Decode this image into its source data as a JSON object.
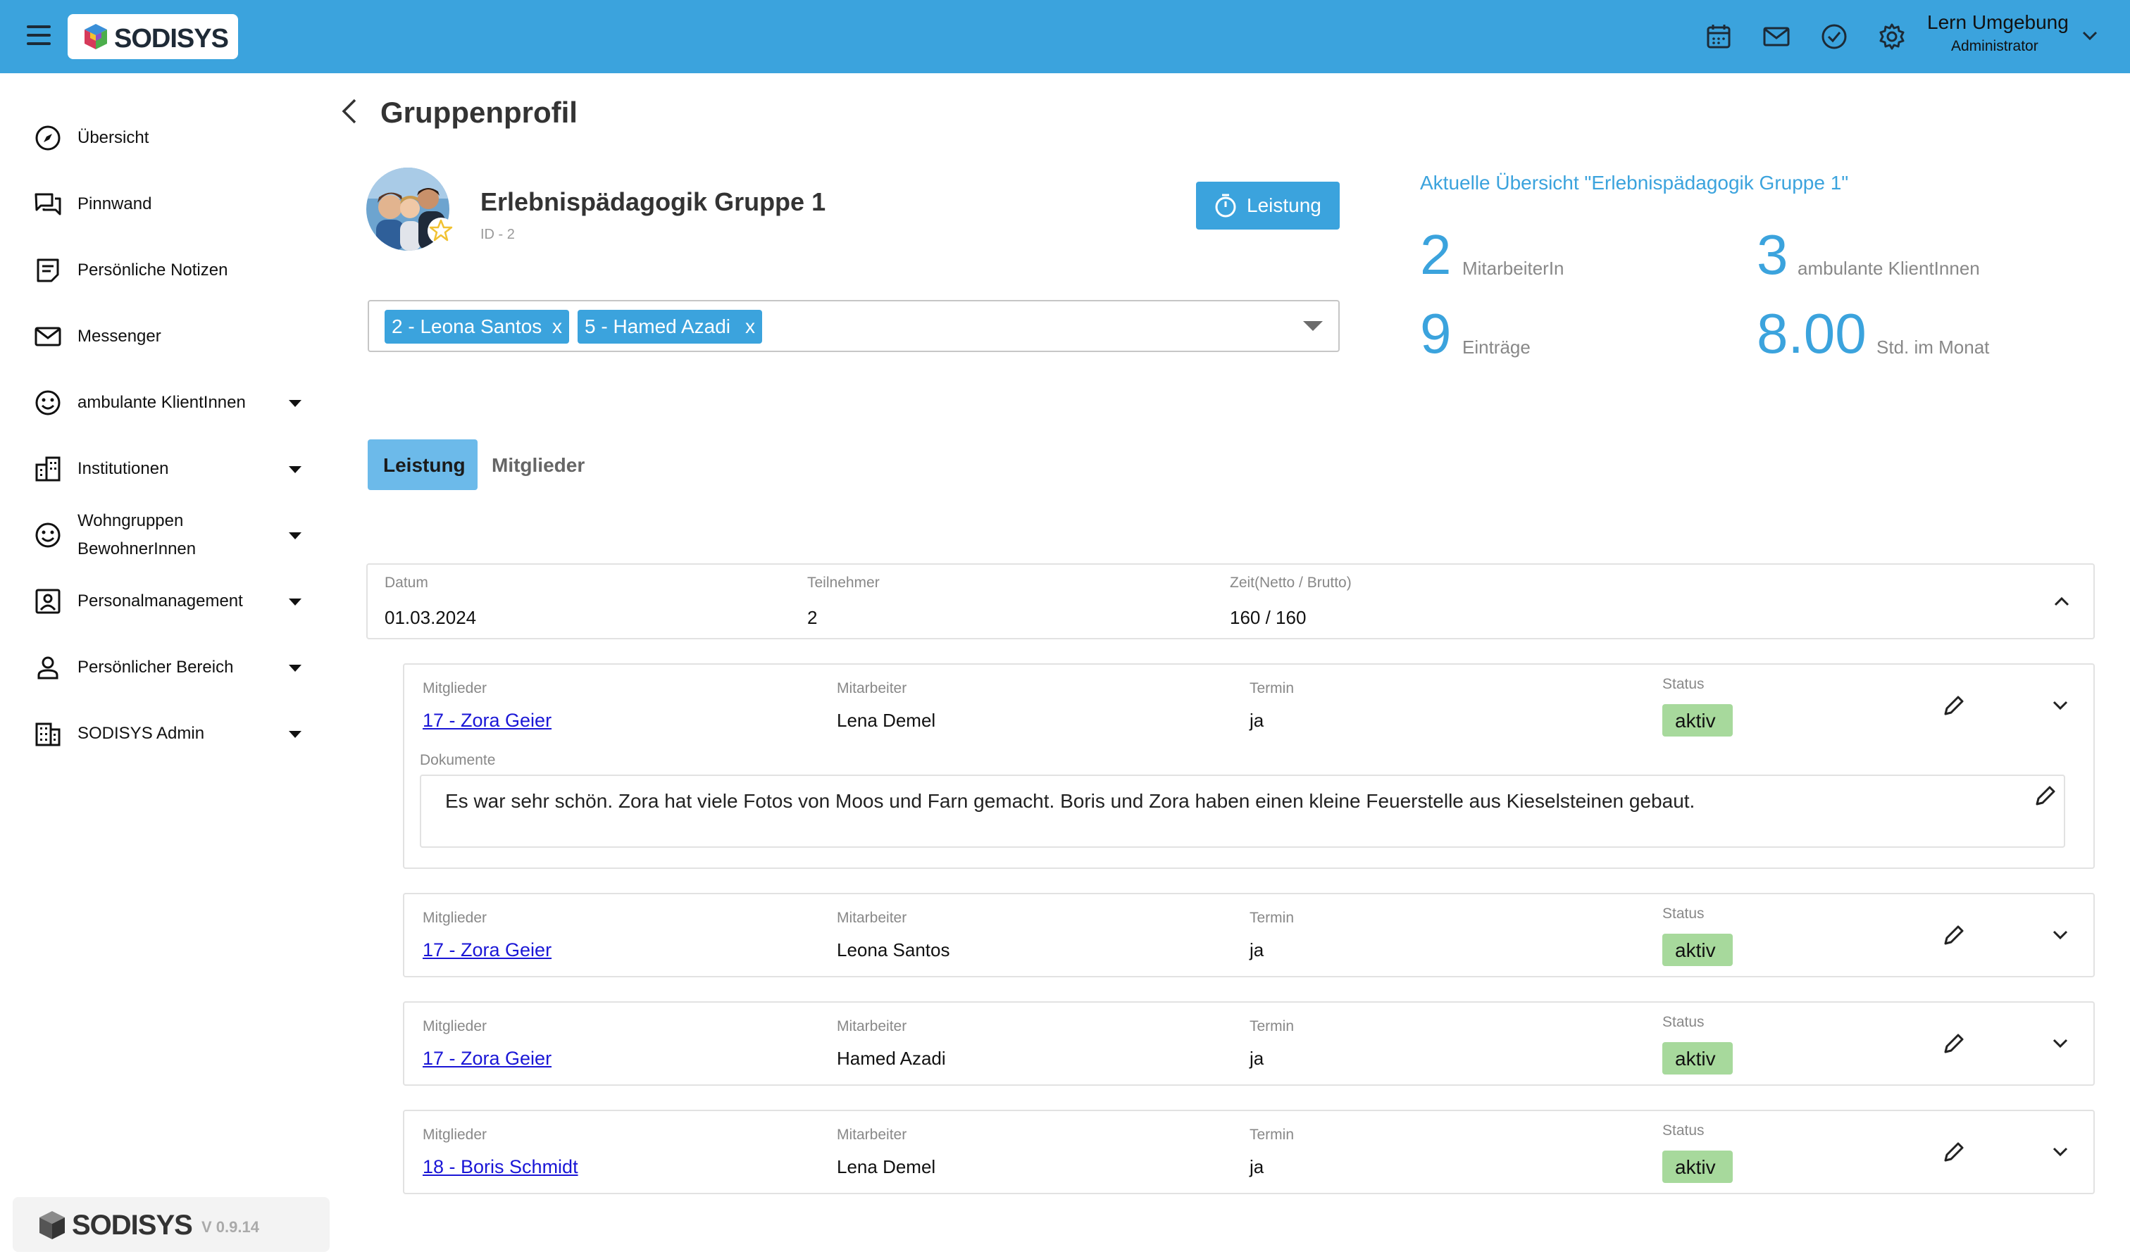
{
  "header": {
    "logo_text": "SODISYS",
    "user_name": "Lern Umgebung",
    "user_role": "Administrator",
    "icons": [
      "calendar-icon",
      "mail-icon",
      "check-circle-icon",
      "gear-icon"
    ]
  },
  "sidebar": {
    "items": [
      {
        "label": "Übersicht",
        "icon": "compass-icon"
      },
      {
        "label": "Pinnwand",
        "icon": "chat-icon"
      },
      {
        "label": "Persönliche Notizen",
        "icon": "note-icon"
      },
      {
        "label": "Messenger",
        "icon": "mail-icon"
      },
      {
        "label": "ambulante KlientInnen",
        "icon": "smiley-icon",
        "expandable": true
      },
      {
        "label": "Institutionen",
        "icon": "building-icon",
        "expandable": true
      },
      {
        "label_line1": "Wohngruppen",
        "label_line2": "BewohnerInnen",
        "icon": "smiley-icon",
        "expandable": true
      },
      {
        "label": "Personalmanagement",
        "icon": "contact-card-icon",
        "expandable": true
      },
      {
        "label": "Persönlicher Bereich",
        "icon": "person-icon",
        "expandable": true
      },
      {
        "label": "SODISYS Admin",
        "icon": "office-icon",
        "expandable": true
      }
    ],
    "footer_logo": "SODISYS",
    "version": "V 0.9.14"
  },
  "page": {
    "title": "Gruppenprofil",
    "group_name": "Erlebnispädagogik Gruppe 1",
    "group_id": "ID - 2",
    "leistung_button": "Leistung",
    "chips": [
      {
        "label": "2 - Leona Santos",
        "remove": "x"
      },
      {
        "label": "5 - Hamed Azadi",
        "remove": "x"
      }
    ]
  },
  "overview": {
    "title": "Aktuelle Übersicht \"Erlebnispädagogik Gruppe 1\"",
    "stats": [
      {
        "value": "2",
        "label": "MitarbeiterIn"
      },
      {
        "value": "3",
        "label": "ambulante KlientInnen"
      },
      {
        "value": "9",
        "label": "Einträge"
      },
      {
        "value": "8.00",
        "label": "Std. im Monat"
      }
    ]
  },
  "tabs": [
    {
      "label": "Leistung",
      "active": true
    },
    {
      "label": "Mitglieder",
      "active": false
    }
  ],
  "summary": {
    "labels": {
      "date": "Datum",
      "participants": "Teilnehmer",
      "time": "Zeit(Netto / Brutto)"
    },
    "date": "01.03.2024",
    "participants": "2",
    "time": "160 / 160"
  },
  "cards": {
    "labels": {
      "member": "Mitglieder",
      "staff": "Mitarbeiter",
      "appointment": "Termin",
      "status": "Status",
      "documents": "Dokumente"
    },
    "rows": [
      {
        "member": "17 - Zora Geier",
        "staff": "Lena Demel",
        "appointment": "ja",
        "status": "aktiv",
        "document": "Es war sehr schön. Zora hat viele Fotos von Moos und Farn gemacht. Boris und Zora haben einen kleine Feuerstelle aus Kieselsteinen gebaut."
      },
      {
        "member": "17 - Zora Geier",
        "staff": "Leona Santos",
        "appointment": "ja",
        "status": "aktiv"
      },
      {
        "member": "17 - Zora Geier",
        "staff": "Hamed Azadi",
        "appointment": "ja",
        "status": "aktiv"
      },
      {
        "member": "18 - Boris Schmidt",
        "staff": "Lena Demel",
        "appointment": "ja",
        "status": "aktiv"
      }
    ]
  },
  "colors": {
    "accent": "#3ba3dd",
    "tab_active": "#6cbaea",
    "status": "#a7d99c",
    "link": "#1a16d6"
  }
}
